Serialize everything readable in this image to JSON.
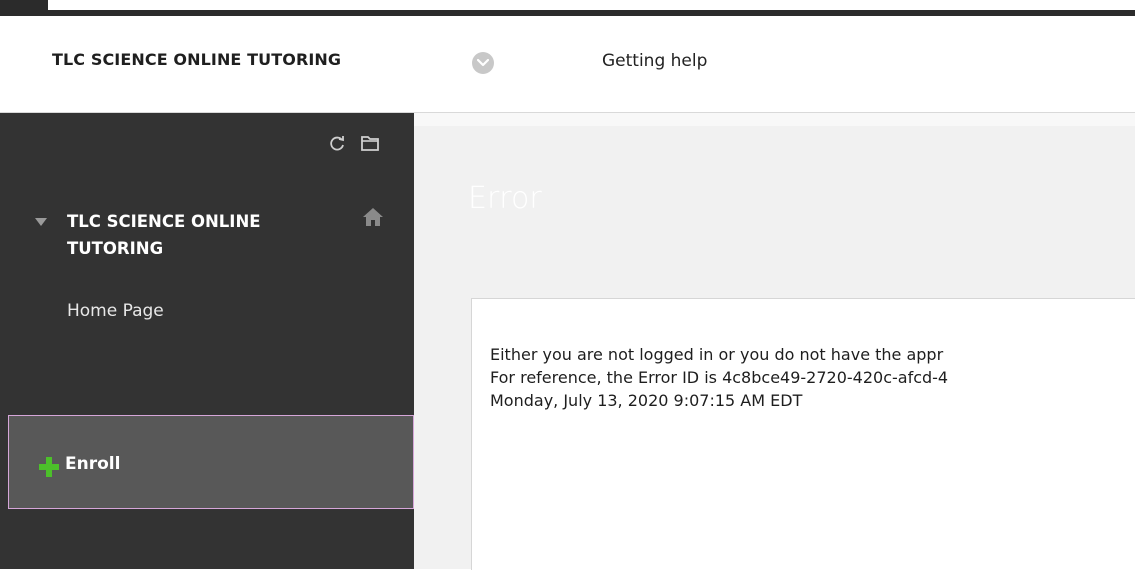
{
  "header": {
    "course_title": "TLC SCIENCE ONLINE TUTORING",
    "menu_link": "Getting help"
  },
  "sidebar": {
    "course_title": "TLC SCIENCE ONLINE TUTORING",
    "items": [
      {
        "label": "Home Page"
      }
    ],
    "enroll_label": "Enroll"
  },
  "main": {
    "page_title": "Error",
    "error_message": [
      "Either you are not logged in or you do not have the appr",
      "For reference, the Error ID is 4c8bce49-2720-420c-afcd-4",
      "Monday, July 13, 2020 9:07:15 AM EDT"
    ]
  },
  "colors": {
    "sidebar_bg": "#333333",
    "enroll_bg": "#585858",
    "enroll_border": "#d6a6d9",
    "enroll_plus": "#4cc02a",
    "content_bg": "#f1f1f1"
  },
  "icons": [
    "chevron-down-icon",
    "refresh-icon",
    "folder-icon",
    "collapse-arrow-icon",
    "home-icon",
    "plus-icon"
  ]
}
